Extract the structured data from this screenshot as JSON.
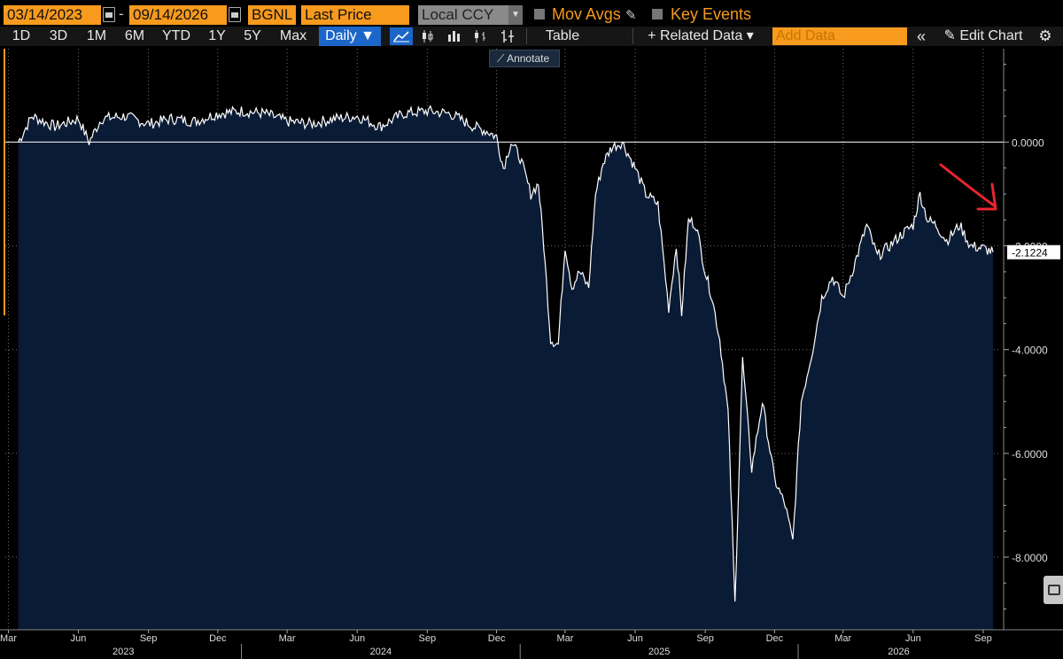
{
  "toolbar": {
    "start_date": "03/14/2023",
    "end_date": "09/14/2026",
    "ticker": "BGNL",
    "field": "Last Price",
    "currency": "Local CCY",
    "mov_avgs": "Mov Avgs",
    "key_events": "Key Events",
    "ranges": [
      "1D",
      "3D",
      "1M",
      "6M",
      "YTD",
      "1Y",
      "5Y",
      "Max"
    ],
    "frequency": "Daily ▼",
    "table": "Table",
    "related_data": "+ Related Data ▾",
    "add_data_placeholder": "Add Data",
    "edit_chart": "Edit Chart",
    "annotate": "Annotate"
  },
  "colors": {
    "accent": "#f79a1d",
    "active": "#1c66c9",
    "area_fill": "#0a1b36",
    "annotation_arrow": "#e8262d"
  },
  "chart_data": {
    "type": "area",
    "ylim": [
      -9.4,
      1.8
    ],
    "yticks": [
      0,
      -2,
      -4,
      -6,
      -8
    ],
    "ytick_labels": [
      "0.0000",
      "-2.0000",
      "-4.0000",
      "-6.0000",
      "-8.0000"
    ],
    "last_value_label": "-2.1224",
    "month_ticks": [
      {
        "label": "Mar",
        "x": "2023-03"
      },
      {
        "label": "Jun",
        "x": "2023-06"
      },
      {
        "label": "Sep",
        "x": "2023-09"
      },
      {
        "label": "Dec",
        "x": "2023-12"
      },
      {
        "label": "Mar",
        "x": "2024-03"
      },
      {
        "label": "Jun",
        "x": "2024-06"
      },
      {
        "label": "Sep",
        "x": "2024-09"
      },
      {
        "label": "Dec",
        "x": "2024-12"
      },
      {
        "label": "Mar",
        "x": "2025-03"
      },
      {
        "label": "Jun",
        "x": "2025-06"
      },
      {
        "label": "Sep",
        "x": "2025-09"
      },
      {
        "label": "Dec",
        "x": "2025-12"
      },
      {
        "label": "Mar",
        "x": "2026-03"
      },
      {
        "label": "Jun",
        "x": "2026-06"
      },
      {
        "label": "Sep",
        "x": "2026-09"
      }
    ],
    "year_labels": [
      "2023",
      "2024",
      "2025",
      "2026"
    ],
    "x": [
      "2023-03-14",
      "2023-04-01",
      "2023-05-01",
      "2023-06-01",
      "2023-06-15",
      "2023-07-01",
      "2023-08-01",
      "2023-09-01",
      "2023-10-01",
      "2023-11-01",
      "2023-12-01",
      "2024-01-01",
      "2024-02-01",
      "2024-03-01",
      "2024-04-01",
      "2024-05-01",
      "2024-06-01",
      "2024-07-01",
      "2024-08-01",
      "2024-09-01",
      "2024-10-01",
      "2024-11-01",
      "2024-11-20",
      "2024-12-01",
      "2024-12-10",
      "2024-12-20",
      "2025-01-01",
      "2025-01-15",
      "2025-01-25",
      "2025-02-01",
      "2025-02-10",
      "2025-02-20",
      "2025-03-01",
      "2025-03-10",
      "2025-03-20",
      "2025-04-01",
      "2025-04-10",
      "2025-04-20",
      "2025-05-01",
      "2025-05-15",
      "2025-06-01",
      "2025-06-15",
      "2025-07-01",
      "2025-07-15",
      "2025-07-25",
      "2025-08-01",
      "2025-08-10",
      "2025-08-20",
      "2025-09-01",
      "2025-09-10",
      "2025-09-20",
      "2025-10-01",
      "2025-10-10",
      "2025-10-20",
      "2025-11-01",
      "2025-11-15",
      "2025-12-01",
      "2025-12-15",
      "2025-12-25",
      "2026-01-05",
      "2026-01-20",
      "2026-02-01",
      "2026-02-15",
      "2026-03-01",
      "2026-03-15",
      "2026-04-01",
      "2026-04-15",
      "2026-05-01",
      "2026-05-15",
      "2026-06-01",
      "2026-06-10",
      "2026-06-20",
      "2026-07-01",
      "2026-07-15",
      "2026-08-01",
      "2026-08-15",
      "2026-09-01",
      "2026-09-14"
    ],
    "values": [
      0.0,
      0.5,
      0.3,
      0.45,
      0.0,
      0.45,
      0.5,
      0.35,
      0.45,
      0.4,
      0.55,
      0.6,
      0.55,
      0.4,
      0.35,
      0.45,
      0.5,
      0.3,
      0.55,
      0.6,
      0.55,
      0.3,
      0.2,
      0.1,
      -0.5,
      0.0,
      -0.3,
      -1.0,
      -0.8,
      -2.0,
      -3.8,
      -3.9,
      -2.0,
      -2.8,
      -2.5,
      -2.8,
      -1.0,
      -0.4,
      -0.1,
      0.0,
      -0.5,
      -1.0,
      -1.2,
      -3.2,
      -2.0,
      -3.3,
      -1.5,
      -1.6,
      -2.5,
      -3.0,
      -3.8,
      -5.2,
      -8.9,
      -4.2,
      -6.3,
      -5.0,
      -6.5,
      -7.0,
      -7.7,
      -5.0,
      -4.0,
      -3.0,
      -2.6,
      -3.0,
      -2.4,
      -1.6,
      -2.2,
      -2.0,
      -1.8,
      -1.6,
      -1.0,
      -1.5,
      -1.6,
      -1.9,
      -1.6,
      -2.0,
      -2.05,
      -2.1224
    ]
  }
}
